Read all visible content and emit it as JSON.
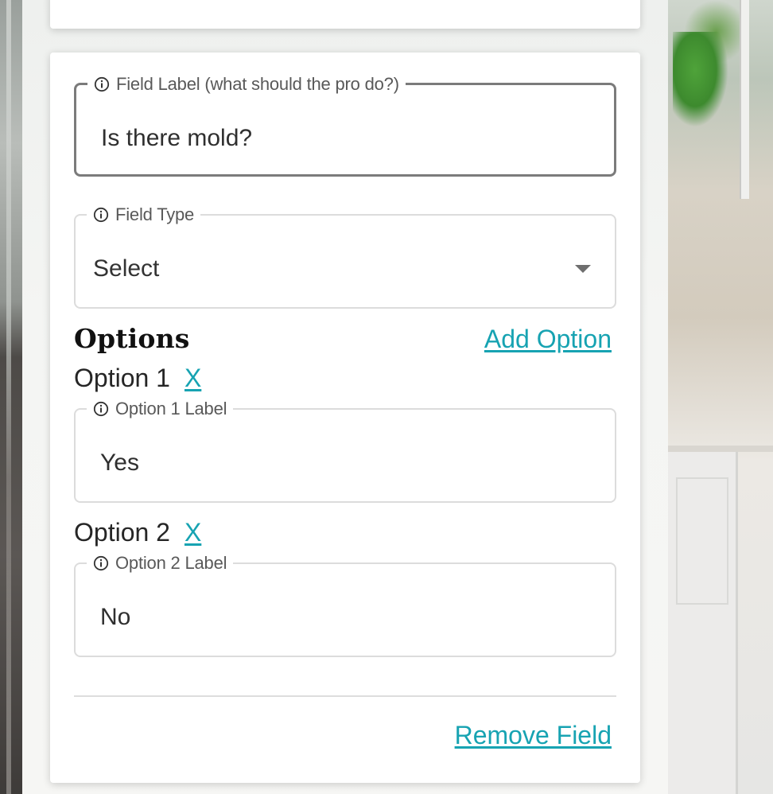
{
  "form": {
    "field_label": {
      "legend": "Field Label (what should the pro do?)",
      "value": "Is there mold?"
    },
    "field_type": {
      "legend": "Field Type",
      "value": "Select"
    },
    "options_heading": "Options",
    "add_option_label": "Add Option",
    "options": [
      {
        "title": "Option 1",
        "remove_label": "X",
        "legend": "Option 1 Label",
        "value": "Yes"
      },
      {
        "title": "Option 2",
        "remove_label": "X",
        "legend": "Option 2 Label",
        "value": "No"
      }
    ],
    "remove_field_label": "Remove Field"
  },
  "icons": {
    "legend_icon": "info-circle-icon",
    "dropdown_icon": "caret-down-icon"
  },
  "colors": {
    "link": "#17a3b2",
    "focused_border": "#7b7b7b",
    "idle_border": "#dcdcdc"
  }
}
